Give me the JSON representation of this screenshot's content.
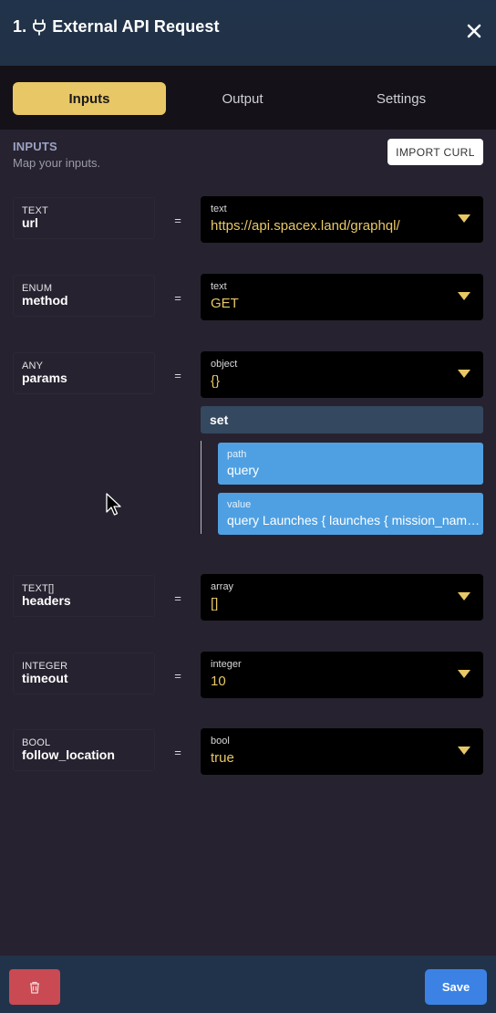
{
  "header": {
    "step_number": "1.",
    "title": "External API Request",
    "icon": "plug-icon",
    "close_icon": "close-icon"
  },
  "tabs": [
    {
      "label": "Inputs",
      "active": true
    },
    {
      "label": "Output",
      "active": false
    },
    {
      "label": "Settings",
      "active": false
    }
  ],
  "inputs_section": {
    "title": "INPUTS",
    "subtitle": "Map your inputs.",
    "import_label": "IMPORT CURL"
  },
  "fields": [
    {
      "type": "TEXT",
      "name": "url",
      "equals": "=",
      "value_type": "text",
      "value": "https://api.spacex.land/graphql/"
    },
    {
      "type": "ENUM",
      "name": "method",
      "equals": "=",
      "value_type": "text",
      "value": "GET"
    },
    {
      "type": "ANY",
      "name": "params",
      "equals": "=",
      "value_type": "object",
      "value": "{}"
    },
    {
      "type": "TEXT[]",
      "name": "headers",
      "equals": "=",
      "value_type": "array",
      "value": "[]"
    },
    {
      "type": "INTEGER",
      "name": "timeout",
      "equals": "=",
      "value_type": "integer",
      "value": "10"
    },
    {
      "type": "BOOL",
      "name": "follow_location",
      "equals": "=",
      "value_type": "bool",
      "value": "true"
    }
  ],
  "params_set": {
    "label": "set",
    "path_key": "path",
    "path_value": "query",
    "value_key": "value",
    "value_value": "query Launches { launches { mission_name } }"
  },
  "footer": {
    "delete_icon": "trash-icon",
    "save_label": "Save"
  },
  "colors": {
    "accent": "#e8c766",
    "header_bg": "#21334a",
    "panel_bg": "#27222f",
    "tab_bar_bg": "#141218",
    "set_bar_bg": "#34485f",
    "kv_bg": "#4fa0e2",
    "delete": "#c94a52",
    "save": "#3b82e4"
  }
}
